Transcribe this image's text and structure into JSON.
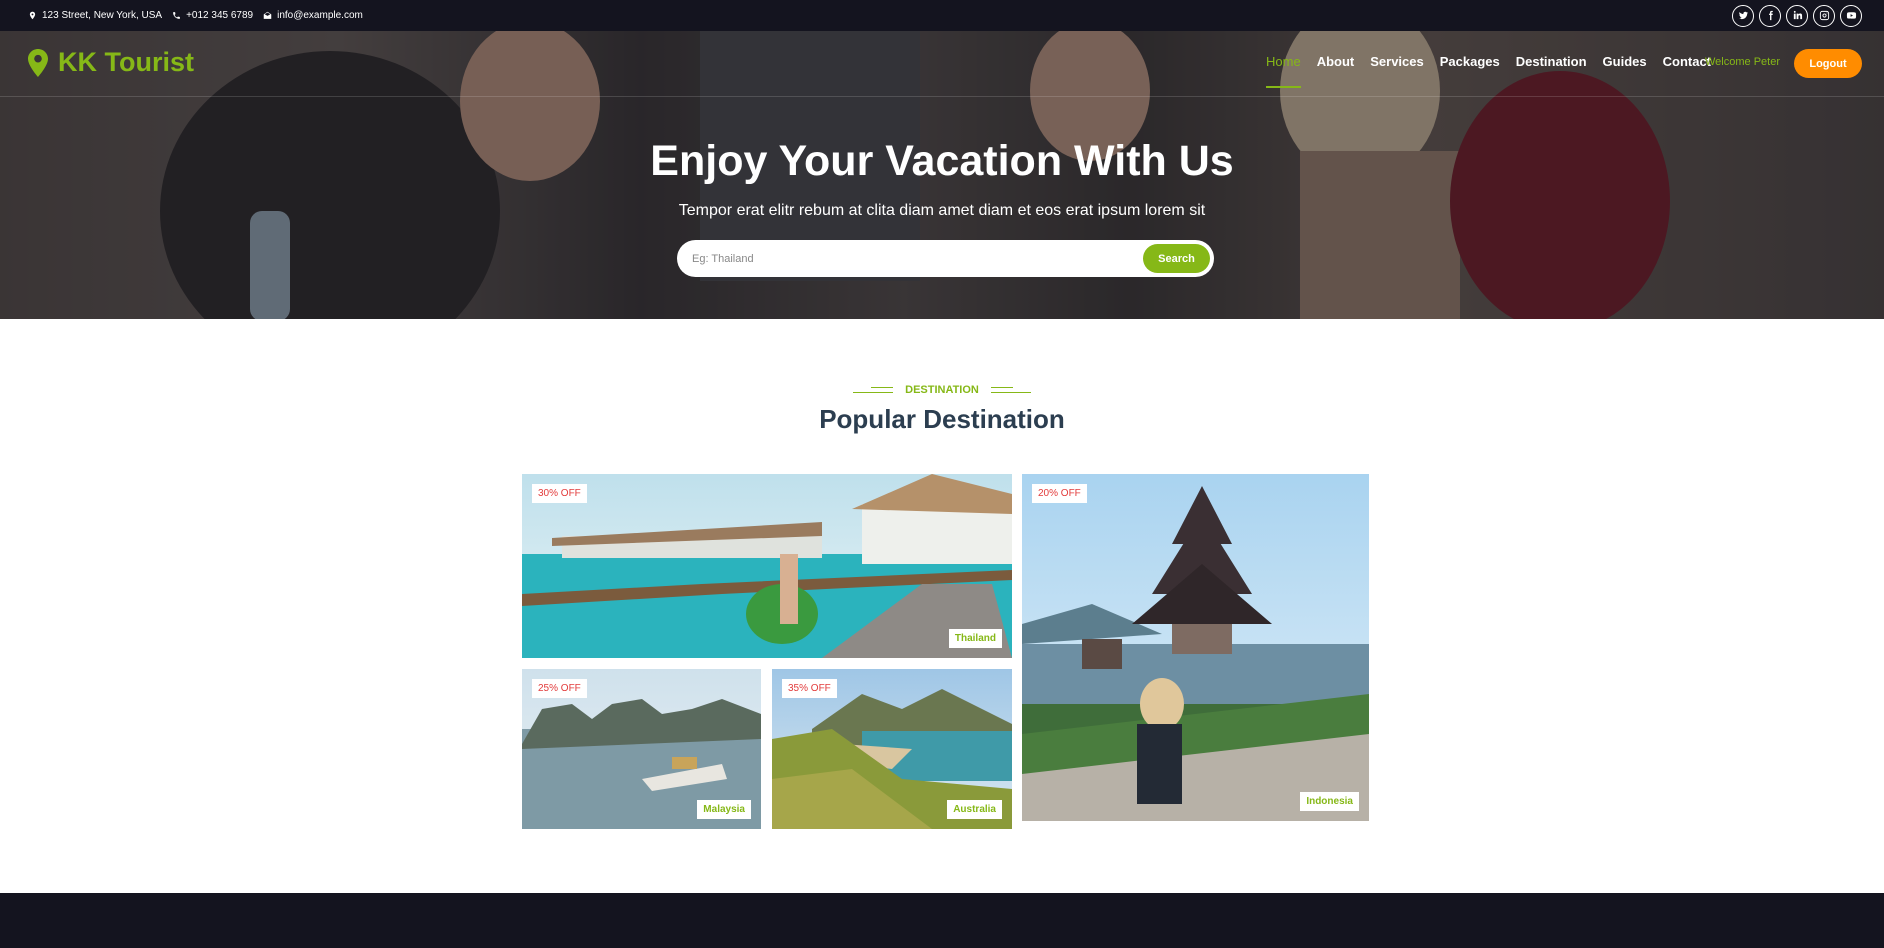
{
  "topbar": {
    "address": "123 Street, New York, USA",
    "phone": "+012 345 6789",
    "email": "info@example.com",
    "socials": [
      "twitter-icon",
      "facebook-icon",
      "linkedin-icon",
      "instagram-icon",
      "youtube-icon"
    ]
  },
  "navbar": {
    "brand": "KK Tourist",
    "menu": [
      "Home",
      "About",
      "Services",
      "Packages",
      "Destination",
      "Guides",
      "Contact"
    ],
    "active_item": "Home",
    "welcome": "Welcome Peter",
    "logout_label": "Logout"
  },
  "hero": {
    "title": "Enjoy Your Vacation With Us",
    "subtitle": "Tempor erat elitr rebum at clita diam amet diam et eos erat ipsum lorem sit",
    "search_placeholder": "Eg: Thailand",
    "search_label": "Search"
  },
  "section": {
    "label": "DESTINATION",
    "title": "Popular Destination"
  },
  "destinations": [
    {
      "discount": "30% OFF",
      "place": "Thailand"
    },
    {
      "discount": "20% OFF",
      "place": "Indonesia"
    },
    {
      "discount": "25% OFF",
      "place": "Malaysia"
    },
    {
      "discount": "35% OFF",
      "place": "Australia"
    }
  ],
  "colors": {
    "accent": "#86b817",
    "logout": "#ff8c00",
    "dark": "#14141f",
    "discount_text": "#e23b3b",
    "heading": "#2c3e50"
  }
}
